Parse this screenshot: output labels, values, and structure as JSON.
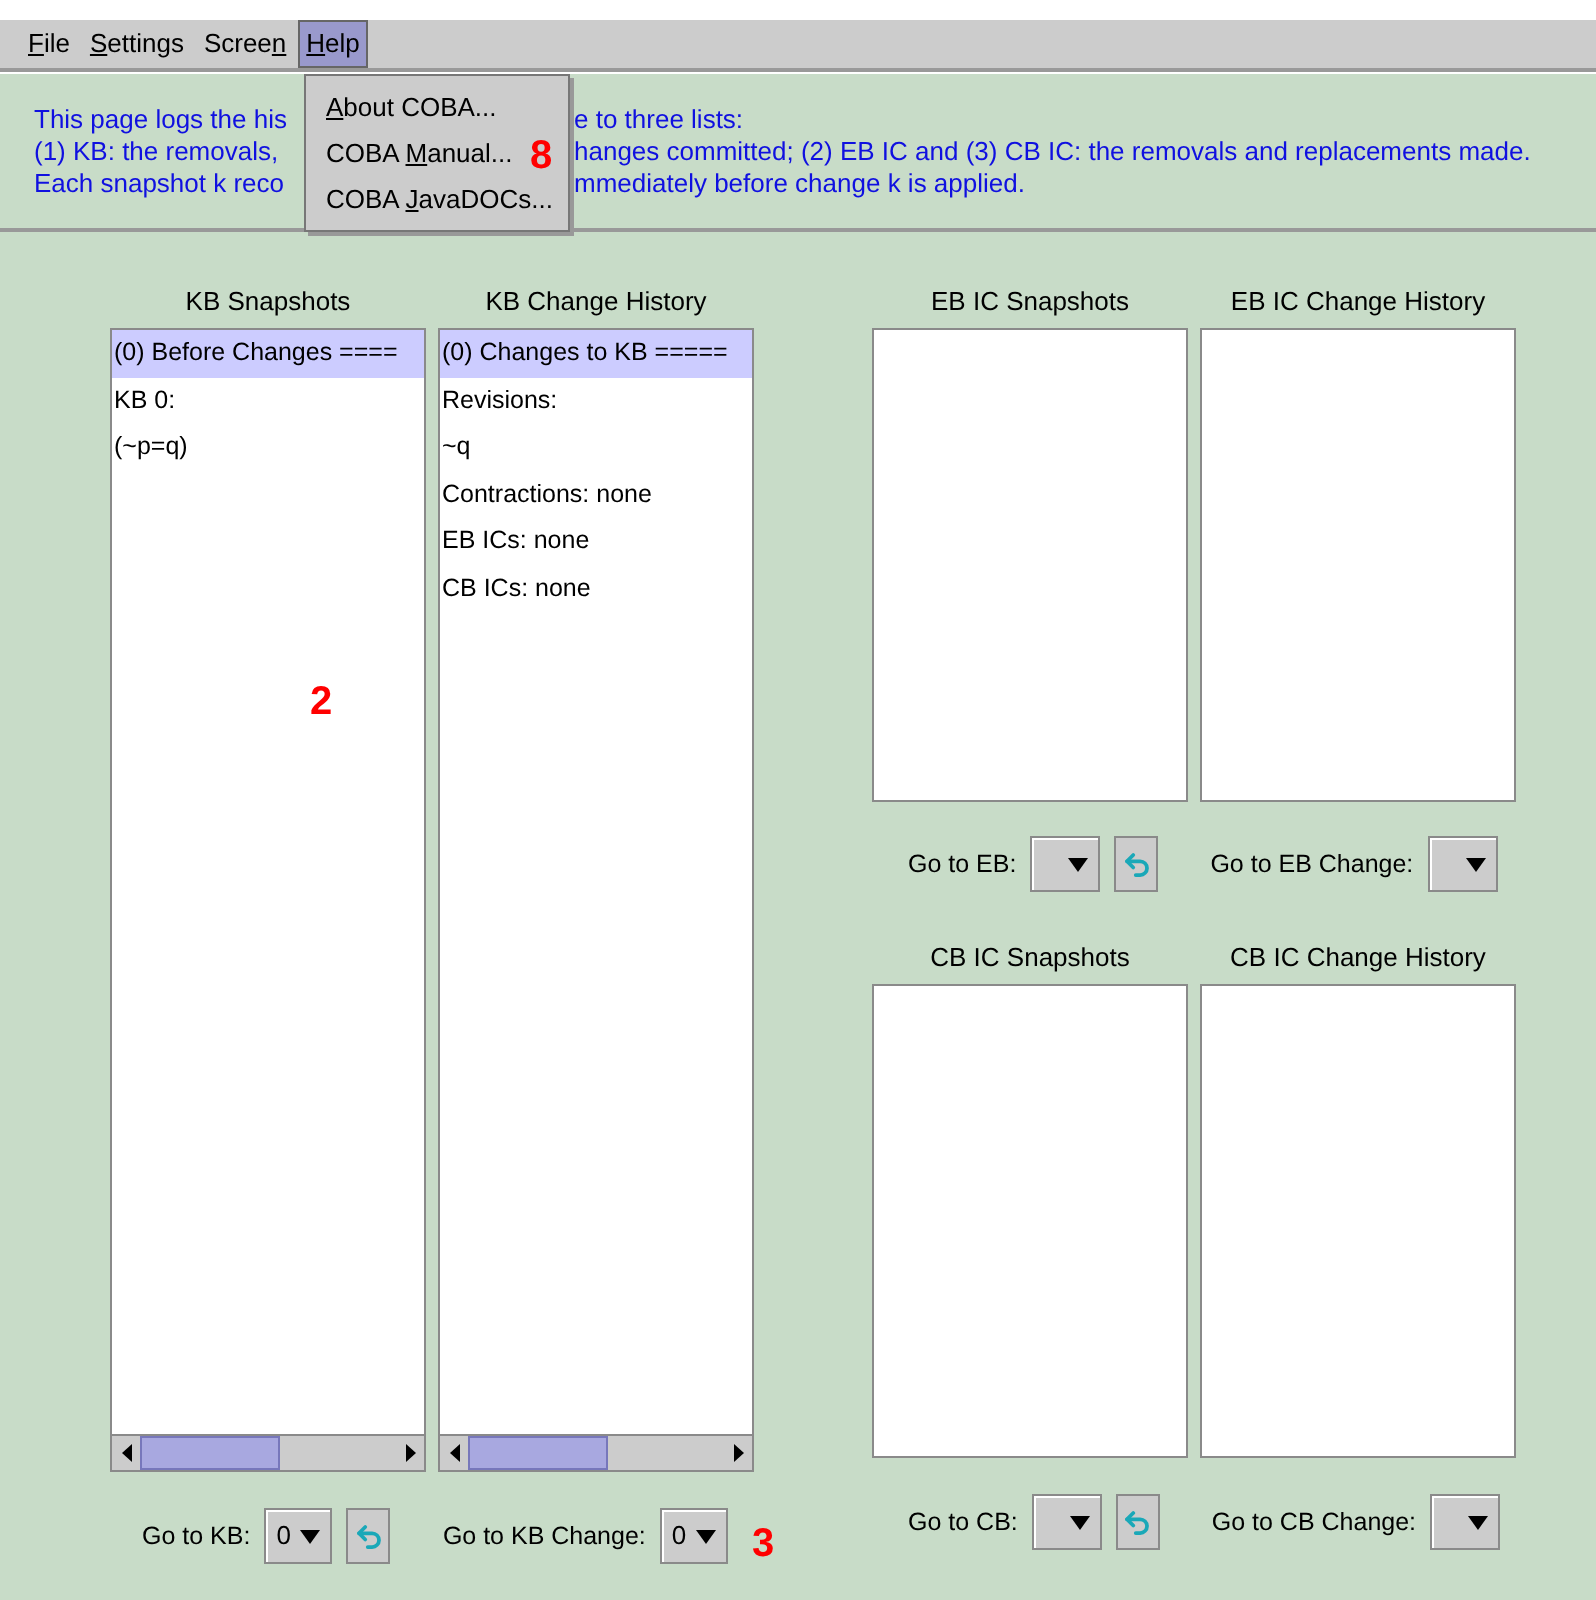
{
  "menubar": [
    {
      "key": "F",
      "post": "ile",
      "selected": false
    },
    {
      "key": "S",
      "post": "ettings",
      "selected": false
    },
    {
      "pre": "Scree",
      "key": "n",
      "selected": false
    },
    {
      "key": "H",
      "post": "elp",
      "selected": true
    }
  ],
  "help_menu": [
    {
      "key": "A",
      "post": "bout COBA..."
    },
    {
      "pre": "COBA ",
      "key": "M",
      "post": "anual..."
    },
    {
      "pre": "COBA ",
      "key": "J",
      "post": "avaDOCs..."
    }
  ],
  "info_lines": [
    {
      "left": "This page logs the his",
      "right": "e to three lists:"
    },
    {
      "left": "(1) KB: the removals,",
      "right": "hanges committed;  (2) EB IC and (3) CB IC: the removals and replacements made."
    },
    {
      "left": "Each snapshot k reco",
      "right": "mmediately before change k is applied."
    }
  ],
  "kb": {
    "lists": [
      {
        "title": "KB Snapshots",
        "items": [
          {
            "text": "(0) Before Changes ====",
            "selected": true
          },
          {
            "text": "KB 0:",
            "selected": false
          },
          {
            "text": "(~p=q)",
            "selected": false
          }
        ]
      },
      {
        "title": "KB Change History",
        "items": [
          {
            "text": "(0) Changes to KB =====",
            "selected": true
          },
          {
            "text": "Revisions:",
            "selected": false
          },
          {
            "text": "~q",
            "selected": false
          },
          {
            "text": "Contractions: none",
            "selected": false
          },
          {
            "text": "EB ICs: none",
            "selected": false
          },
          {
            "text": "CB ICs: none",
            "selected": false
          }
        ]
      }
    ],
    "controls": [
      {
        "label": "Go to KB:",
        "value": "0",
        "refresh": true
      },
      {
        "label": "Go to KB Change:",
        "value": "0",
        "refresh": false
      }
    ]
  },
  "eb": {
    "lists": [
      {
        "title": "EB IC Snapshots"
      },
      {
        "title": "EB IC Change History"
      }
    ],
    "controls": [
      {
        "label": "Go to EB:",
        "refresh": true
      },
      {
        "label": "Go to EB Change:",
        "refresh": false
      }
    ]
  },
  "cb": {
    "lists": [
      {
        "title": "CB IC Snapshots"
      },
      {
        "title": "CB IC Change History"
      }
    ],
    "controls": [
      {
        "label": "Go to CB:",
        "refresh": true
      },
      {
        "label": "Go to CB Change:",
        "refresh": false
      }
    ]
  },
  "annotations": [
    "8",
    "2",
    "3"
  ]
}
